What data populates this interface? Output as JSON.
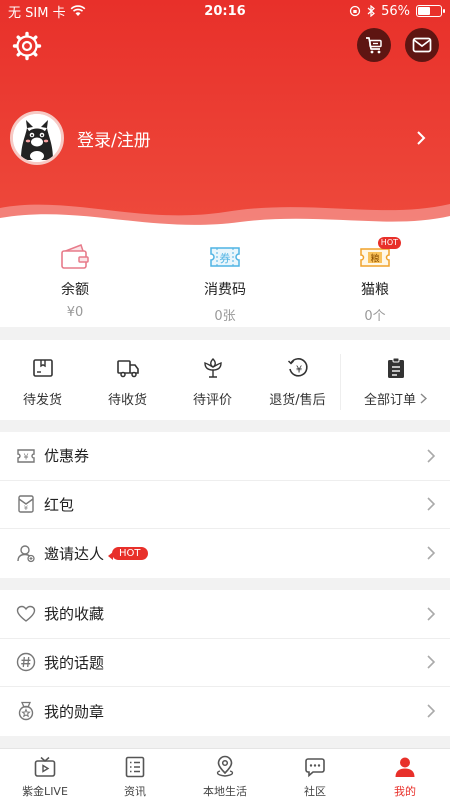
{
  "status_bar": {
    "carrier": "无 SIM 卡",
    "time": "20:16",
    "battery": "56%",
    "battery_level": 0.56
  },
  "header": {
    "login_text": "登录/注册"
  },
  "stats": [
    {
      "label": "余额",
      "value": "¥0",
      "icon": "wallet-icon"
    },
    {
      "label": "消费码",
      "value": "0张",
      "icon": "ticket-icon",
      "icon_text": "券"
    },
    {
      "label": "猫粮",
      "value": "0个",
      "icon": "cat-food-icon",
      "icon_text": "粮",
      "badge": "HOT"
    }
  ],
  "orders": [
    {
      "label": "待发货",
      "icon": "box-icon"
    },
    {
      "label": "待收货",
      "icon": "truck-icon"
    },
    {
      "label": "待评价",
      "icon": "flower-icon"
    },
    {
      "label": "退货/售后",
      "icon": "refund-icon"
    },
    {
      "label": "全部订单",
      "icon": "clipboard-icon"
    }
  ],
  "menu_group_1": [
    {
      "label": "优惠券",
      "icon": "coupon-icon"
    },
    {
      "label": "红包",
      "icon": "red-envelope-icon"
    },
    {
      "label": "邀请达人",
      "icon": "invite-user-icon",
      "badge": "HOT"
    }
  ],
  "menu_group_2": [
    {
      "label": "我的收藏",
      "icon": "heart-icon"
    },
    {
      "label": "我的话题",
      "icon": "hashtag-icon"
    },
    {
      "label": "我的勋章",
      "icon": "medal-icon"
    }
  ],
  "tabbar": [
    {
      "label": "紫金LIVE",
      "icon": "tv-icon"
    },
    {
      "label": "资讯",
      "icon": "news-icon"
    },
    {
      "label": "本地生活",
      "icon": "location-icon"
    },
    {
      "label": "社区",
      "icon": "community-icon"
    },
    {
      "label": "我的",
      "icon": "user-icon",
      "active": true
    }
  ],
  "colors": {
    "accent": "#e8302a",
    "header_dark": "#5e1512"
  }
}
